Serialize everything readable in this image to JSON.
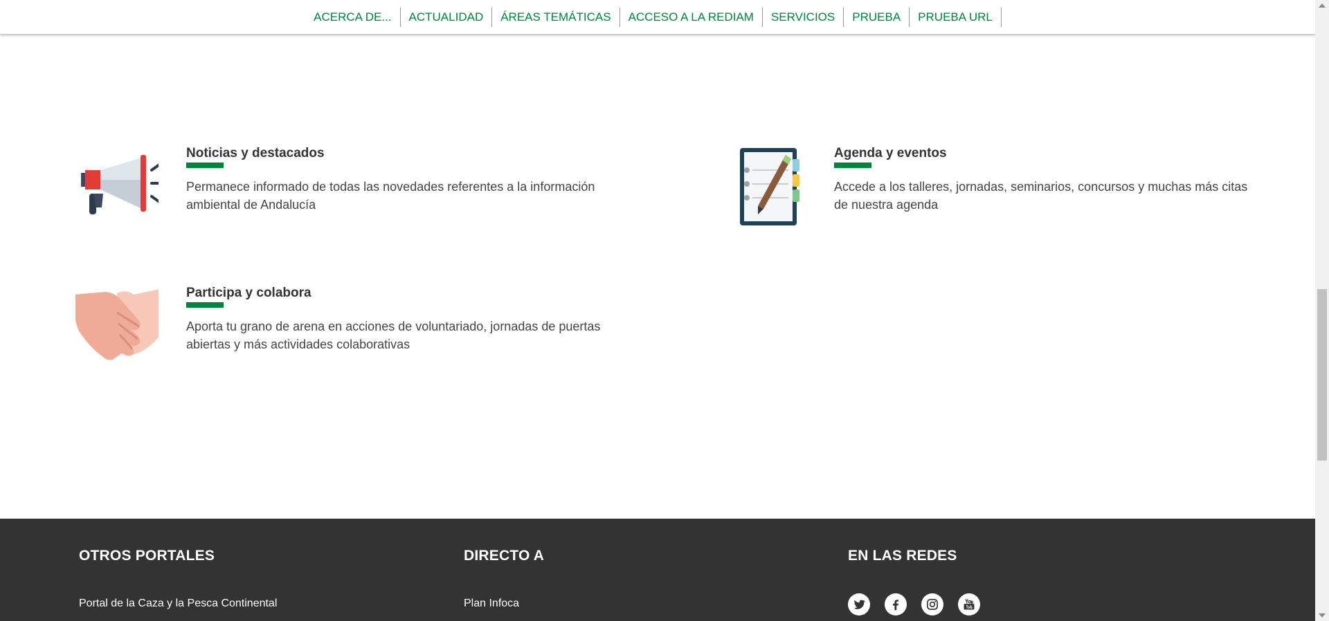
{
  "nav": {
    "items": [
      {
        "label": "ACERCA DE..."
      },
      {
        "label": "ACTUALIDAD"
      },
      {
        "label": "ÁREAS TEMÁTICAS"
      },
      {
        "label": "ACCESO A LA REDIAM"
      },
      {
        "label": "SERVICIOS"
      },
      {
        "label": "PRUEBA"
      },
      {
        "label": "PRUEBA URL"
      }
    ],
    "color": "#00833e"
  },
  "cards": [
    {
      "title": "Noticias y destacados",
      "text": "Permanece informado de todas las novedades referentes a la información ambiental de Andalucía",
      "icon": "megaphone-icon"
    },
    {
      "title": "Agenda y eventos",
      "text": "Accede a los talleres, jornadas, seminarios, concursos y muchas más citas de nuestra agenda",
      "icon": "notebook-pen-icon"
    },
    {
      "title": "Participa y colabora",
      "text": "Aporta tu grano de arena en acciones de voluntariado, jornadas de puertas abiertas y más actividades colaborativas",
      "icon": "handshake-icon"
    }
  ],
  "footer": {
    "background": "#333333",
    "cols": [
      {
        "title": "OTROS PORTALES",
        "link": "Portal de la Caza y la Pesca Continental"
      },
      {
        "title": "DIRECTO A",
        "link": "Plan Infoca"
      },
      {
        "title": "EN LAS REDES"
      }
    ],
    "social": [
      "twitter-icon",
      "facebook-icon",
      "instagram-icon",
      "youtube-icon"
    ]
  }
}
